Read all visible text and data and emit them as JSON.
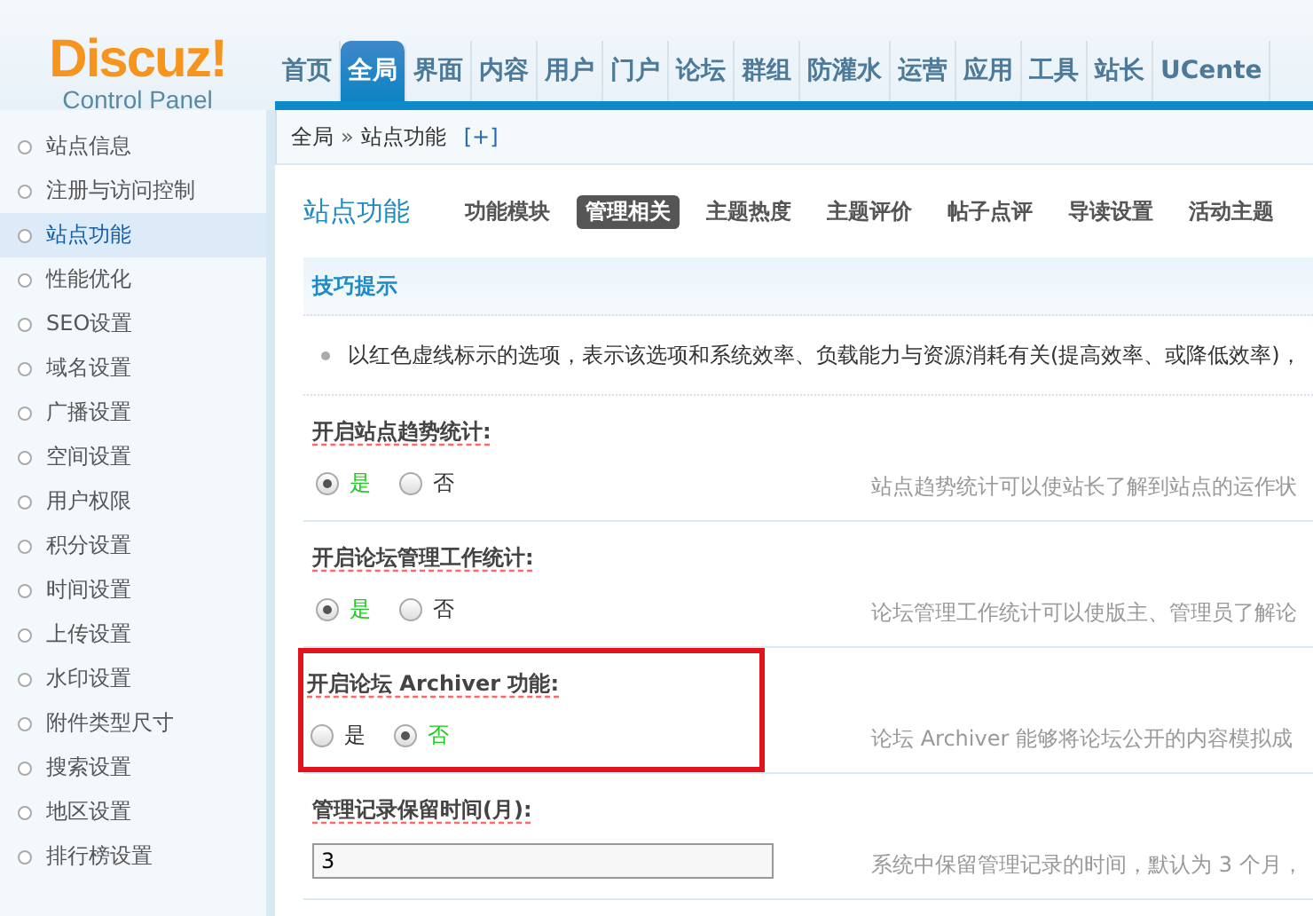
{
  "logo": {
    "title": "Discuz!",
    "subtitle": "Control Panel"
  },
  "nav": [
    {
      "label": "首页",
      "selected": false
    },
    {
      "label": "全局",
      "selected": true
    },
    {
      "label": "界面",
      "selected": false
    },
    {
      "label": "内容",
      "selected": false
    },
    {
      "label": "用户",
      "selected": false
    },
    {
      "label": "门户",
      "selected": false
    },
    {
      "label": "论坛",
      "selected": false
    },
    {
      "label": "群组",
      "selected": false
    },
    {
      "label": "防灌水",
      "selected": false
    },
    {
      "label": "运营",
      "selected": false
    },
    {
      "label": "应用",
      "selected": false
    },
    {
      "label": "工具",
      "selected": false
    },
    {
      "label": "站长",
      "selected": false
    },
    {
      "label": "UCente",
      "selected": false
    }
  ],
  "breadcrumb": {
    "items": [
      "全局",
      "站点功能"
    ],
    "separator": "»",
    "add": "[+]"
  },
  "sidebar": {
    "items": [
      {
        "label": "站点信息",
        "selected": false
      },
      {
        "label": "注册与访问控制",
        "selected": false
      },
      {
        "label": "站点功能",
        "selected": true
      },
      {
        "label": "性能优化",
        "selected": false
      },
      {
        "label": "SEO设置",
        "selected": false
      },
      {
        "label": "域名设置",
        "selected": false
      },
      {
        "label": "广播设置",
        "selected": false
      },
      {
        "label": "空间设置",
        "selected": false
      },
      {
        "label": "用户权限",
        "selected": false
      },
      {
        "label": "积分设置",
        "selected": false
      },
      {
        "label": "时间设置",
        "selected": false
      },
      {
        "label": "上传设置",
        "selected": false
      },
      {
        "label": "水印设置",
        "selected": false
      },
      {
        "label": "附件类型尺寸",
        "selected": false
      },
      {
        "label": "搜索设置",
        "selected": false
      },
      {
        "label": "地区设置",
        "selected": false
      },
      {
        "label": "排行榜设置",
        "selected": false
      }
    ]
  },
  "page_title": "站点功能",
  "subtabs": [
    {
      "label": "功能模块",
      "selected": false
    },
    {
      "label": "管理相关",
      "selected": true
    },
    {
      "label": "主题热度",
      "selected": false
    },
    {
      "label": "主题评价",
      "selected": false
    },
    {
      "label": "帖子点评",
      "selected": false
    },
    {
      "label": "导读设置",
      "selected": false
    },
    {
      "label": "活动主题",
      "selected": false
    }
  ],
  "tips": {
    "title": "技巧提示",
    "items": [
      "以红色虚线标示的选项，表示该选项和系统效率、负载能力与资源消耗有关(提高效率、或降低效率)，"
    ]
  },
  "settings": [
    {
      "kind": "radio",
      "label": "开启站点趋势统计:",
      "highlighted": false,
      "options": [
        {
          "label": "是",
          "selected": true
        },
        {
          "label": "否",
          "selected": false
        }
      ],
      "description": "站点趋势统计可以使站长了解到站点的运作状"
    },
    {
      "kind": "radio",
      "label": "开启论坛管理工作统计:",
      "highlighted": false,
      "options": [
        {
          "label": "是",
          "selected": true
        },
        {
          "label": "否",
          "selected": false
        }
      ],
      "description": "论坛管理工作统计可以使版主、管理员了解论"
    },
    {
      "kind": "radio",
      "label": "开启论坛 Archiver 功能:",
      "highlighted": true,
      "options": [
        {
          "label": "是",
          "selected": false
        },
        {
          "label": "否",
          "selected": true
        }
      ],
      "description": "论坛 Archiver 能够将论坛公开的内容模拟成"
    },
    {
      "kind": "text",
      "label": "管理记录保留时间(月):",
      "highlighted": false,
      "value": "3",
      "description": "系统中保留管理记录的时间，默认为 3 个月，"
    }
  ]
}
